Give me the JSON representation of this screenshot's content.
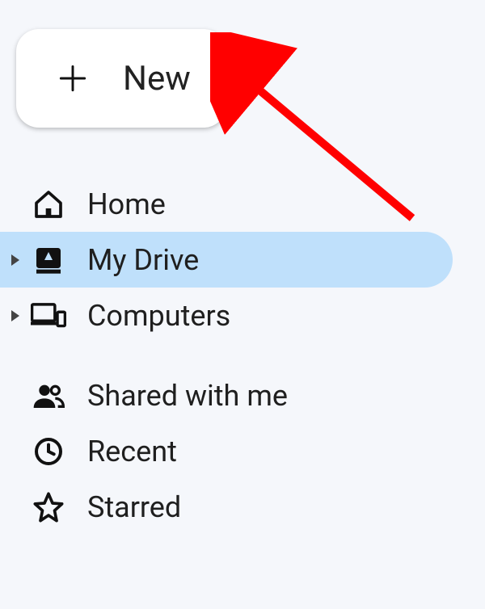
{
  "new_button": {
    "label": "New"
  },
  "sidebar": {
    "items": [
      {
        "label": "Home"
      },
      {
        "label": "My Drive"
      },
      {
        "label": "Computers"
      },
      {
        "label": "Shared with me"
      },
      {
        "label": "Recent"
      },
      {
        "label": "Starred"
      }
    ]
  },
  "annotation": {
    "arrow_color": "#ff0000"
  }
}
